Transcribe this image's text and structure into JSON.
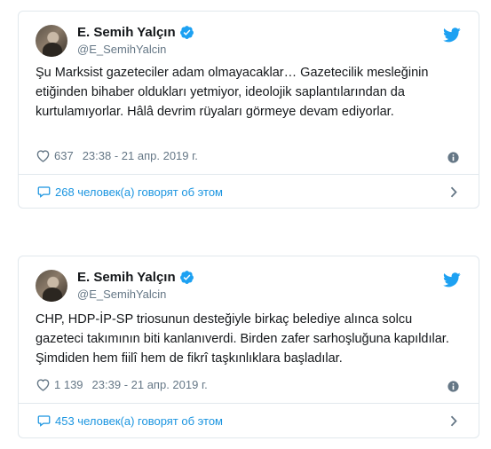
{
  "tweets": [
    {
      "author_name": "E. Semih Yalçın",
      "handle": "@E_SemihYalcin",
      "text": "Şu Marksist gazeteciler adam olmayacaklar… Gazetecilik mesleğinin etiğinden bihaber oldukları yetmiyor, ideolojik saplantılarından da kurtulamıyorlar. Hâlâ devrim rüyaları görmeye devam ediyorlar.",
      "likes": "637",
      "timestamp": "23:38 - 21 апр. 2019 г.",
      "talking_label": "268 человек(а) говорят об этом"
    },
    {
      "author_name": "E. Semih Yalçın",
      "handle": "@E_SemihYalcin",
      "text": "CHP, HDP-İP-SP triosunun desteğiyle birkaç belediye alınca solcu gazeteci takımının biti kanlanıverdi. Birden zafer sarhoşluğuna kapıldılar. Şimdiden hem fiilî hem de fikrî taşkınlıklara başladılar.",
      "likes": "1 139",
      "timestamp": "23:39 - 21 апр. 2019 г.",
      "talking_label": "453 человек(а) говорят об этом"
    }
  ],
  "colors": {
    "twitter_blue": "#1da1f2",
    "link_blue": "#1b95e0",
    "secondary_text": "#657786",
    "border": "#e1e8ed"
  },
  "icons": [
    "avatar",
    "verified-badge-icon",
    "twitter-bird-icon",
    "heart-icon",
    "info-icon",
    "speech-bubble-icon",
    "chevron-right-icon"
  ]
}
